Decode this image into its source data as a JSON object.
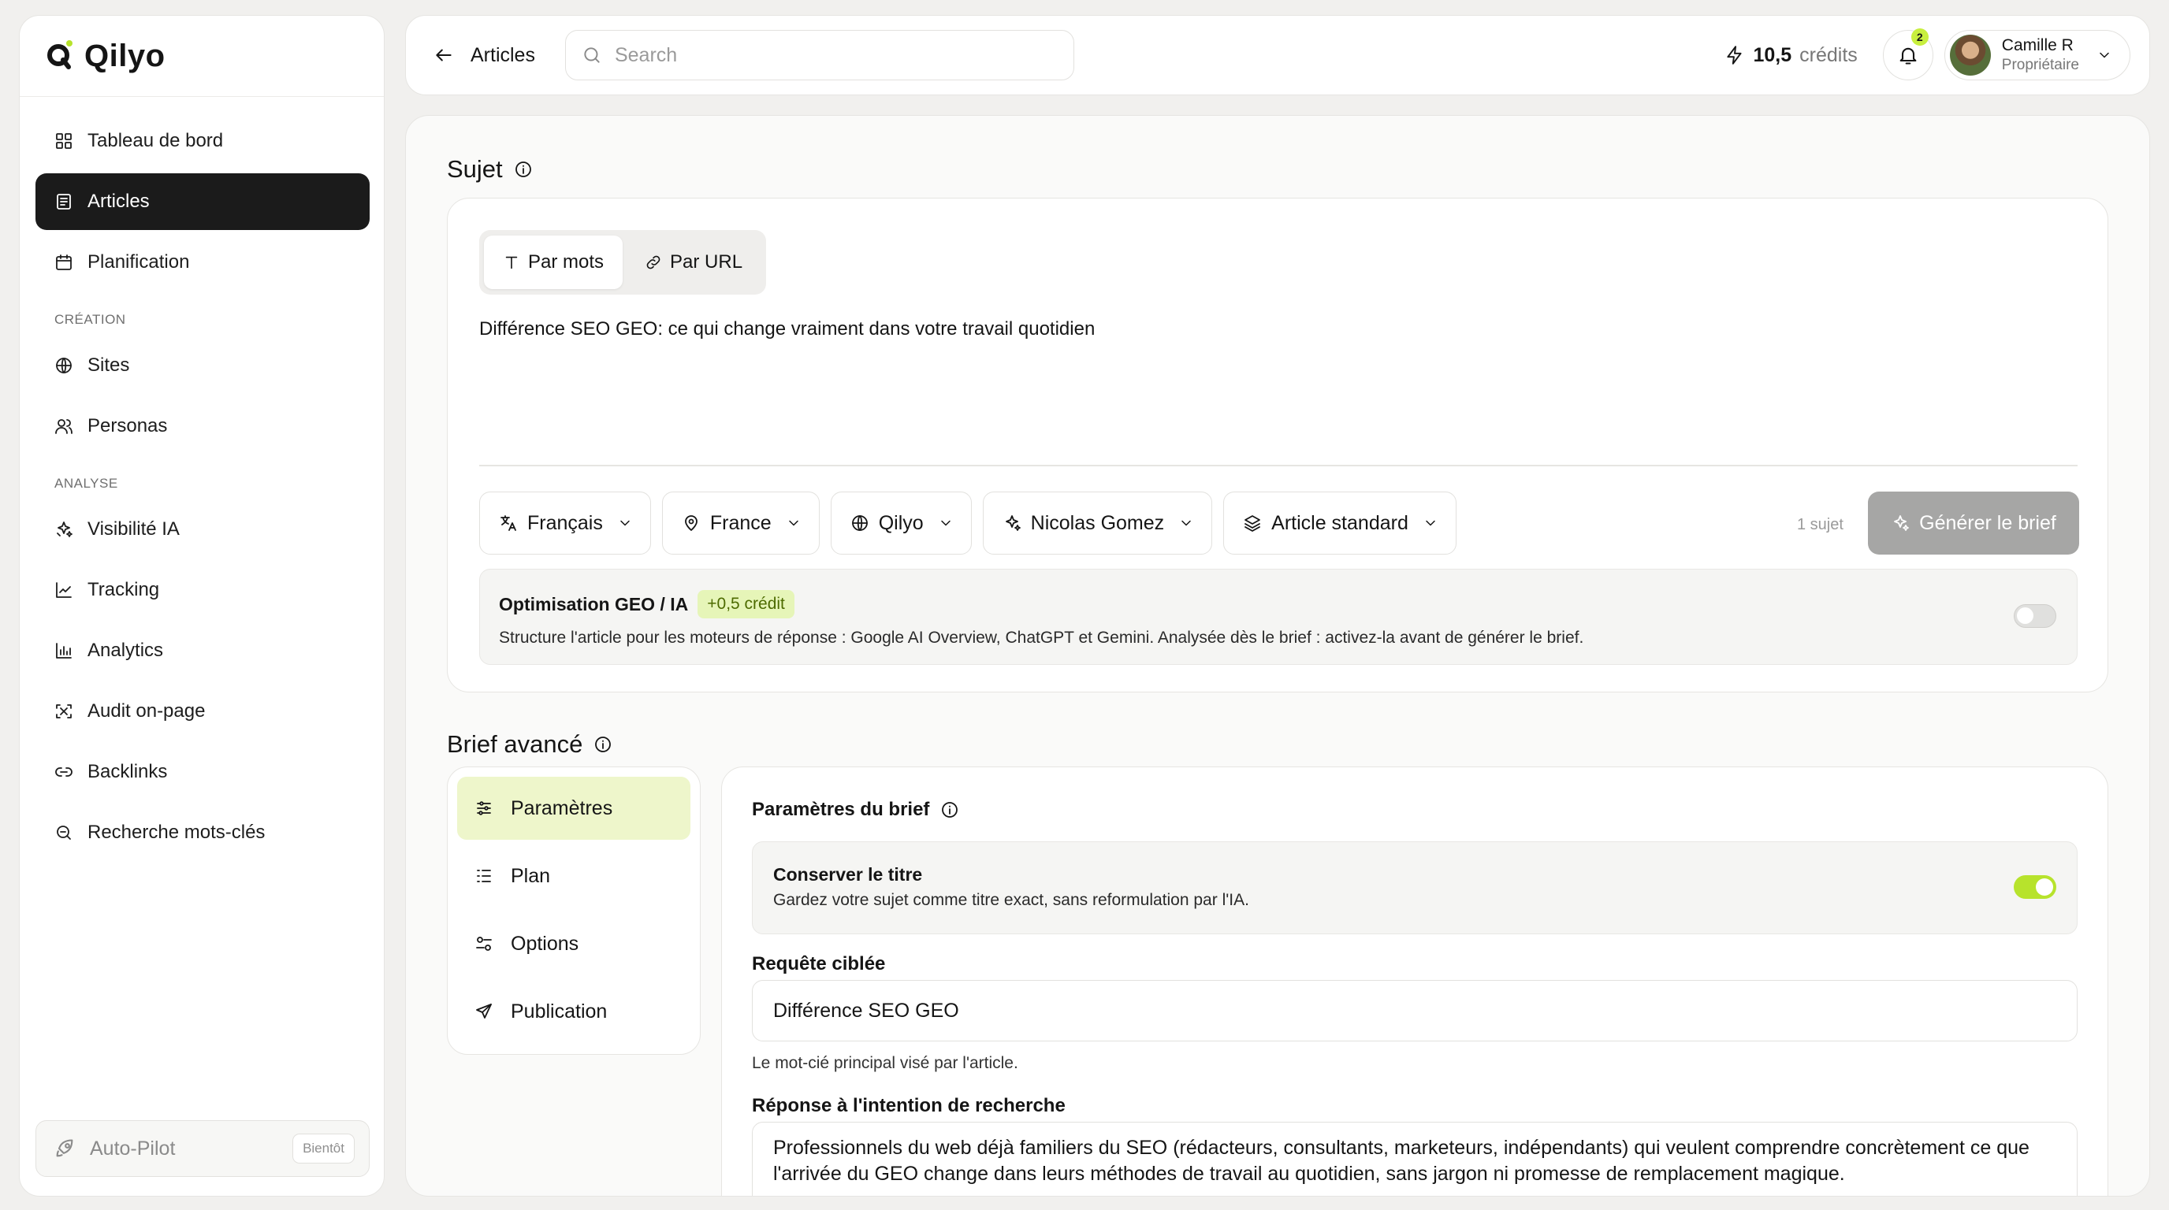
{
  "app": {
    "name": "Qilyo"
  },
  "sidebar": {
    "items": [
      {
        "label": "Tableau de bord",
        "icon": "dashboard-icon"
      },
      {
        "label": "Articles",
        "icon": "articles-icon",
        "active": true
      },
      {
        "label": "Planification",
        "icon": "calendar-icon"
      }
    ],
    "section_creation": "CRÉATION",
    "creation_items": [
      {
        "label": "Sites",
        "icon": "globe-icon"
      },
      {
        "label": "Personas",
        "icon": "users-icon"
      }
    ],
    "section_analyse": "ANALYSE",
    "analyse_items": [
      {
        "label": "Visibilité IA",
        "icon": "sparkles-icon"
      },
      {
        "label": "Tracking",
        "icon": "line-chart-icon"
      },
      {
        "label": "Analytics",
        "icon": "bar-chart-icon"
      },
      {
        "label": "Audit on-page",
        "icon": "scan-icon"
      },
      {
        "label": "Backlinks",
        "icon": "link-icon"
      },
      {
        "label": "Recherche mots-clés",
        "icon": "keyword-search-icon"
      }
    ],
    "autopilot": {
      "label": "Auto-Pilot",
      "badge": "Bientôt"
    }
  },
  "topbar": {
    "breadcrumb": "Articles",
    "search_placeholder": "Search",
    "credits_value": "10,5",
    "credits_label": "crédits",
    "notifications_count": "2",
    "user_name": "Camille R",
    "user_role": "Propriétaire"
  },
  "subject": {
    "title": "Sujet",
    "tabs": [
      {
        "label": "Par mots"
      },
      {
        "label": "Par URL"
      }
    ],
    "text": "Différence SEO GEO: ce qui change vraiment dans votre travail quotidien",
    "filters": {
      "language": "Français",
      "country": "France",
      "site": "Qilyo",
      "persona": "Nicolas Gomez",
      "format": "Article standard"
    },
    "count": "1 sujet",
    "generate_label": "Générer le brief",
    "geo": {
      "title": "Optimisation GEO / IA",
      "badge": "+0,5 crédit",
      "description": "Structure l'article pour les moteurs de réponse : Google AI Overview, ChatGPT et Gemini. Analysée dès le brief : activez-la avant de générer le brief.",
      "enabled": false
    }
  },
  "brief": {
    "title": "Brief avancé",
    "menu": [
      {
        "label": "Paramètres",
        "icon": "sliders-icon"
      },
      {
        "label": "Plan",
        "icon": "list-icon"
      },
      {
        "label": "Options",
        "icon": "toggles-icon"
      },
      {
        "label": "Publication",
        "icon": "send-icon"
      }
    ],
    "params_title": "Paramètres du brief",
    "keep_title": {
      "label": "Conserver le titre",
      "description": "Gardez votre sujet comme titre exact, sans reformulation par l'IA.",
      "enabled": true
    },
    "target_query": {
      "label": "Requête ciblée",
      "value": "Différence SEO GEO",
      "hint": "Le mot-cié principal visé par l'article."
    },
    "intent": {
      "label": "Réponse à l'intention de recherche",
      "value": "Professionnels du web déjà familiers du SEO (rédacteurs, consultants, marketeurs, indépendants) qui veulent comprendre concrètement ce que l'arrivée du GEO change dans leurs méthodes de travail au quotidien, sans jargon ni promesse de remplacement magique."
    }
  },
  "colors": {
    "accent": "#c8ef3e",
    "active_nav": "#1b1b1b",
    "selected_menu": "#eef6cb",
    "toggle_on": "#b7e32c",
    "button_disabled": "#a6a6a5"
  }
}
